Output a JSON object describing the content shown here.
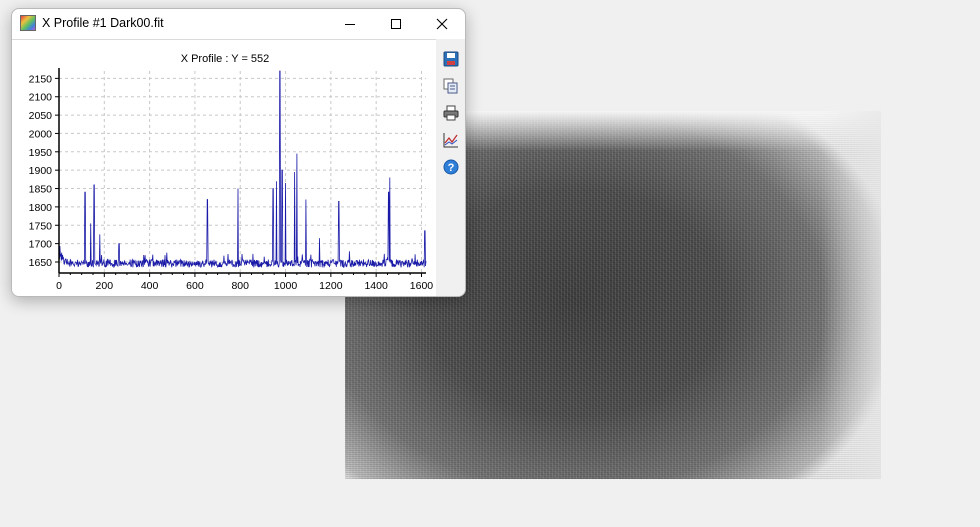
{
  "window": {
    "title": "X Profile #1 Dark00.fit",
    "minimize_icon": "minimize-icon",
    "maximize_icon": "maximize-icon",
    "close_icon": "close-icon"
  },
  "toolbar": {
    "items": [
      {
        "icon": "save-icon"
      },
      {
        "icon": "copy-icon"
      },
      {
        "icon": "print-icon"
      },
      {
        "icon": "chart-options-icon"
      },
      {
        "icon": "help-icon"
      }
    ]
  },
  "chart_data": {
    "type": "line",
    "title": "X Profile :   Y = 552",
    "xlabel": "",
    "ylabel": "",
    "xlim": [
      0,
      1620
    ],
    "ylim": [
      1620,
      2170
    ],
    "x_ticks": [
      0,
      200,
      400,
      600,
      800,
      1000,
      1200,
      1400,
      1600
    ],
    "y_ticks": [
      1650,
      1700,
      1750,
      1800,
      1850,
      1900,
      1950,
      2000,
      2050,
      2100,
      2150
    ],
    "grid": true,
    "line_color": "#1a1aa8",
    "baseline": 1645,
    "spikes": [
      {
        "x": 115,
        "y": 1840
      },
      {
        "x": 140,
        "y": 1755
      },
      {
        "x": 155,
        "y": 1860
      },
      {
        "x": 180,
        "y": 1725
      },
      {
        "x": 265,
        "y": 1700
      },
      {
        "x": 655,
        "y": 1820
      },
      {
        "x": 790,
        "y": 1850
      },
      {
        "x": 945,
        "y": 1850
      },
      {
        "x": 960,
        "y": 1870
      },
      {
        "x": 975,
        "y": 2170
      },
      {
        "x": 985,
        "y": 1900
      },
      {
        "x": 1000,
        "y": 1865
      },
      {
        "x": 1040,
        "y": 1895
      },
      {
        "x": 1050,
        "y": 1945
      },
      {
        "x": 1090,
        "y": 1820
      },
      {
        "x": 1150,
        "y": 1715
      },
      {
        "x": 1235,
        "y": 1815
      },
      {
        "x": 1455,
        "y": 1840
      },
      {
        "x": 1460,
        "y": 1880
      },
      {
        "x": 1615,
        "y": 1735
      }
    ]
  }
}
